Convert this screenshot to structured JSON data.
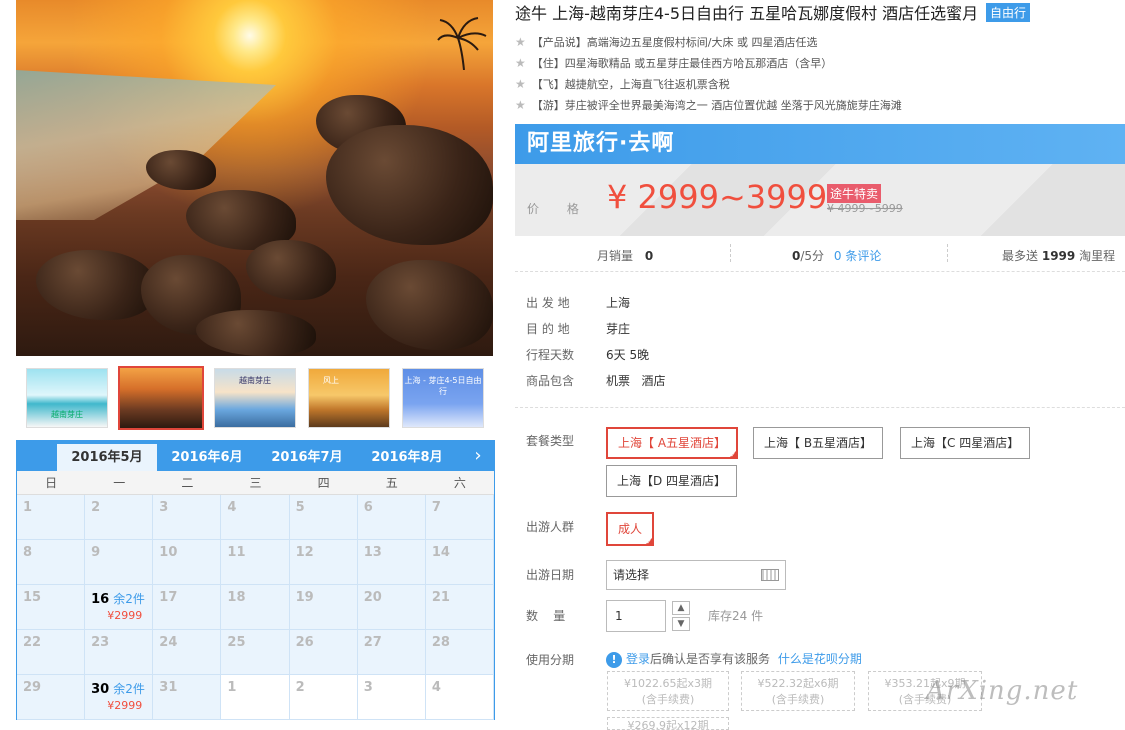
{
  "product": {
    "title": "途牛 上海-越南芽庄4-5日自由行 五星哈瓦娜度假村 酒店任选蜜月",
    "badge": "自由行",
    "features": [
      "【产品说】高端海边五星度假村标间/大床 或 四星酒店任选",
      "【住】四星海歌精品 或五星芽庄最佳西方哈瓦那酒店（含早）",
      "【飞】越捷航空，上海直飞往返机票含税",
      "【游】芽庄被评全世界最美海湾之一 酒店位置优越 坐落于风光旖旎芽庄海滩"
    ]
  },
  "gallery": {
    "thumbs": [
      "越南芽庄",
      "",
      "越南芽庄",
      "风上",
      "上海 - 芽庄4-5日自由行"
    ]
  },
  "calendar": {
    "tabs": [
      "2016年5月",
      "2016年6月",
      "2016年7月",
      "2016年8月"
    ],
    "weekdays": [
      "日",
      "一",
      "二",
      "三",
      "四",
      "五",
      "六"
    ],
    "stock_text": "余2件",
    "price_text": "¥2999",
    "days": [
      "1",
      "2",
      "3",
      "4",
      "5",
      "6",
      "7",
      "8",
      "9",
      "10",
      "11",
      "12",
      "13",
      "14",
      "15",
      "16",
      "17",
      "18",
      "19",
      "20",
      "21",
      "22",
      "23",
      "24",
      "25",
      "26",
      "27",
      "28",
      "29",
      "30",
      "31",
      "1",
      "2",
      "3",
      "4"
    ]
  },
  "price": {
    "banner": "阿里旅行·去啊",
    "label": "价 格",
    "main": "¥ 2999~3999",
    "tag": "途牛特卖",
    "original": "¥ 4999~5999"
  },
  "stats": {
    "monthly_sales_label": "月销量",
    "monthly_sales": "0",
    "rating": "0",
    "rating_suffix": "/5分",
    "reviews": "0 条评论",
    "miles_prefix": "最多送",
    "miles": "1999",
    "miles_suffix": "淘里程"
  },
  "info": {
    "rows": [
      {
        "k": "出 发 地",
        "v": "上海"
      },
      {
        "k": "目 的 地",
        "v": "芽庄"
      },
      {
        "k": "行程天数",
        "v": "6天 5晚"
      },
      {
        "k": "商品包含",
        "v": "机票   酒店"
      }
    ]
  },
  "options": {
    "package_label": "套餐类型",
    "packages": [
      "上海【 A五星酒店】",
      "上海【 B五星酒店】",
      "上海【C 四星酒店】",
      "上海【D 四星酒店】"
    ],
    "traveler_label": "出游人群",
    "traveler": "成人",
    "date_label": "出游日期",
    "date_placeholder": "请选择",
    "qty_label": "数    量",
    "qty_value": "1",
    "stock": "库存24 件",
    "installment_label": "使用分期",
    "installment_login": "登录",
    "installment_note": "后确认是否享有该服务",
    "installment_link": "什么是花呗分期",
    "installments": [
      {
        "price": "¥1022.65起x3期",
        "fee": "(含手续费)"
      },
      {
        "price": "¥522.32起x6期",
        "fee": "(含手续费)"
      },
      {
        "price": "¥353.21起x9期",
        "fee": "(含手续费)"
      },
      {
        "price": "¥269.9起x12期",
        "fee": ""
      }
    ]
  },
  "watermark": "ArXing.net",
  "colors": {
    "accent": "#3d9be9",
    "price": "#f04f3e",
    "selected": "#e0463a"
  }
}
